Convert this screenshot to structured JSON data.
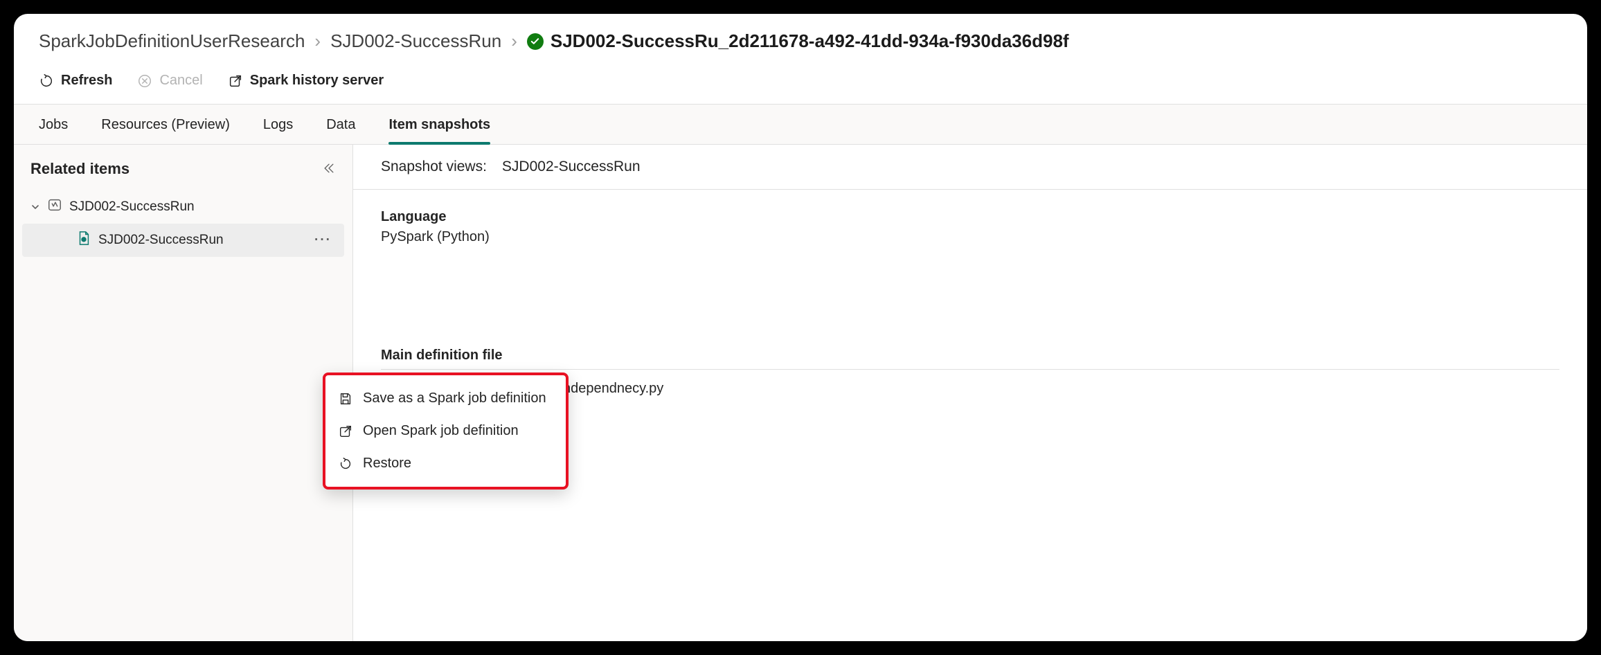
{
  "breadcrumb": {
    "items": [
      {
        "label": "SparkJobDefinitionUserResearch"
      },
      {
        "label": "SJD002-SuccessRun"
      }
    ],
    "current": "SJD002-SuccessRu_2d211678-a492-41dd-934a-f930da36d98f"
  },
  "toolbar": {
    "refresh": "Refresh",
    "cancel": "Cancel",
    "history": "Spark history server"
  },
  "tabs": [
    {
      "label": "Jobs",
      "active": false
    },
    {
      "label": "Resources (Preview)",
      "active": false
    },
    {
      "label": "Logs",
      "active": false
    },
    {
      "label": "Data",
      "active": false
    },
    {
      "label": "Item snapshots",
      "active": true
    }
  ],
  "sidebar": {
    "title": "Related items",
    "tree": {
      "root_label": "SJD002-SuccessRun",
      "child_label": "SJD002-SuccessRun"
    }
  },
  "snapshot": {
    "views_label": "Snapshot views:",
    "views_value": "SJD002-SuccessRun",
    "language_label": "Language",
    "language_value": "PySpark (Python)",
    "main_file_label": "Main definition file",
    "main_file_value": "createTablefromCSVwithdependnecy.py"
  },
  "context_menu": {
    "save_as": "Save as a Spark job definition",
    "open": "Open Spark job definition",
    "restore": "Restore"
  }
}
